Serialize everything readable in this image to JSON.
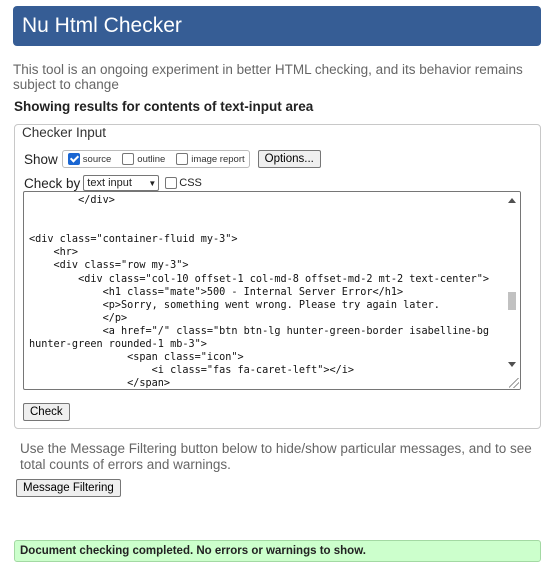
{
  "header": {
    "title": "Nu Html Checker"
  },
  "intro": "This tool is an ongoing experiment in better HTML checking, and its behavior remains subject to change",
  "results_heading": "Showing results for contents of text-input area",
  "checker_input": {
    "legend": "Checker Input",
    "show_label": "Show",
    "options": [
      {
        "label": "source",
        "checked": true
      },
      {
        "label": "outline",
        "checked": false
      },
      {
        "label": "image report",
        "checked": false
      }
    ],
    "options_button": "Options...",
    "check_by_label": "Check by",
    "check_by_value": "text input",
    "css_label": "CSS",
    "css_checked": false,
    "code_lines": [
      "        </div>",
      "",
      "",
      "<div class=\"container-fluid my-3\">",
      "    <hr>",
      "    <div class=\"row my-3\">",
      "        <div class=\"col-10 offset-1 col-md-8 offset-md-2 mt-2 text-center\">",
      "            <h1 class=\"mate\">500 - Internal Server Error</h1>",
      "            <p>Sorry, something went wrong. Please try again later.",
      "            </p>",
      "            <a href=\"/\" class=\"btn btn-lg hunter-green-border isabelline-bg",
      "hunter-green rounded-1 mb-3\">",
      "                <span class=\"icon\">",
      "                    <i class=\"fas fa-caret-left\"></i>",
      "                </span>"
    ],
    "check_button": "Check"
  },
  "filter_text": "Use the Message Filtering button below to hide/show particular messages, and to see total counts of errors and warnings.",
  "filter_button": "Message Filtering",
  "status": "Document checking completed. No errors or warnings to show.",
  "colors": {
    "header_bg": "#365d95",
    "status_bg": "#ccffcc",
    "checkbox_on": "#1a66d2"
  }
}
